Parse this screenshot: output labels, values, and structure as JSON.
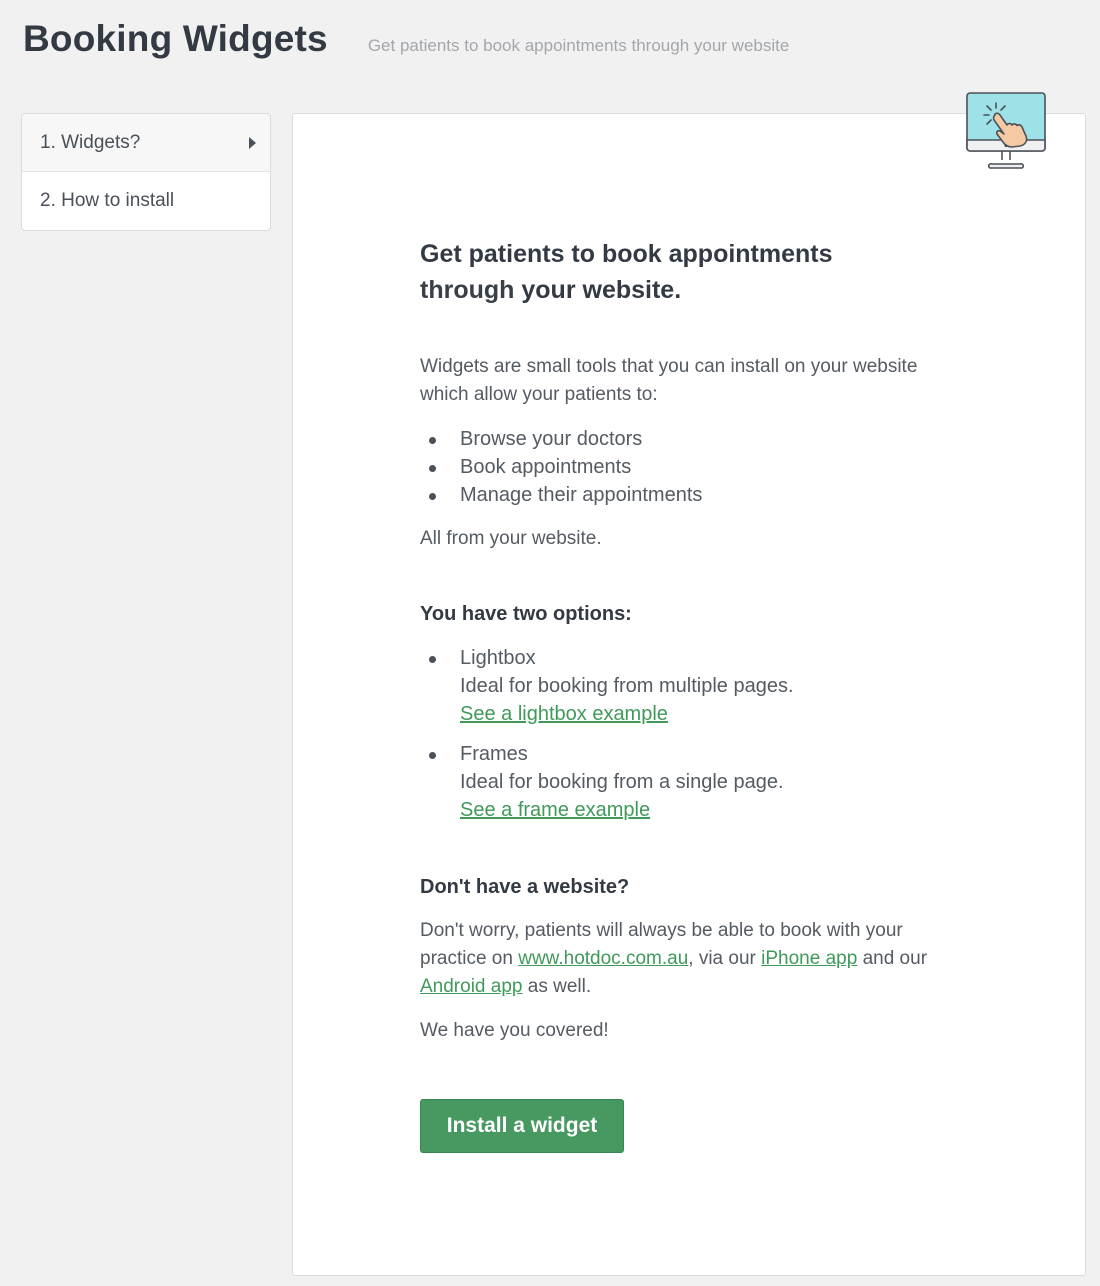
{
  "header": {
    "title": "Booking Widgets",
    "subtitle": "Get patients to book appointments through your website"
  },
  "sidebar": {
    "items": [
      {
        "label": "1. Widgets?",
        "active": true
      },
      {
        "label": "2. How to install",
        "active": false
      }
    ]
  },
  "illustration": {
    "icon": "monitor-click-icon"
  },
  "main": {
    "headline_part1": "Get patients to book appointments",
    "headline_part2": "through",
    "headline_bold": "your website",
    "headline_end": ".",
    "intro_line1": "Widgets are small tools that you can install on your website",
    "intro_line2": "which allow your patients to:",
    "features": [
      "Browse your doctors",
      "Book appointments",
      "Manage their appointments"
    ],
    "all_from": "All from your website.",
    "options_heading": "You have two options:",
    "options": [
      {
        "name": "Lightbox",
        "desc": "Ideal for booking from multiple pages.",
        "link": "See a lightbox example"
      },
      {
        "name": "Frames",
        "desc": "Ideal for booking from a single page.",
        "link": "See a frame example"
      }
    ],
    "no_site_heading": "Don't have a website?",
    "no_site_line1": "Don't worry, patients will always be able to book with your",
    "no_site_practice": "practice on",
    "hotdoc_link": "www.hotdoc.com.au",
    "via_our": ", via our",
    "iphone_link": "iPhone app",
    "and_our": "and our",
    "android_link": "Android app",
    "as_well": "as well.",
    "covered": "We have you covered!",
    "install_button": "Install a widget"
  },
  "colors": {
    "accent": "#479961",
    "link": "#3f9a5a",
    "screen": "#9ee1e6"
  }
}
